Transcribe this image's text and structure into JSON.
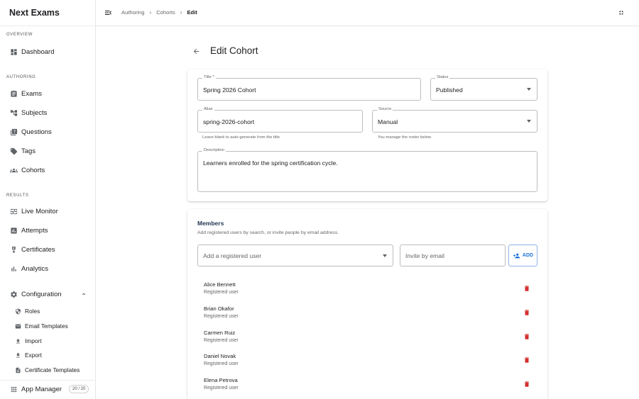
{
  "app": {
    "title": "Next Exams"
  },
  "sidebar": {
    "sections": {
      "overview": "OVERVIEW",
      "authoring": "AUTHORING",
      "results": "RESULTS"
    },
    "items": {
      "dashboard": "Dashboard",
      "exams": "Exams",
      "subjects": "Subjects",
      "questions": "Questions",
      "tags": "Tags",
      "cohorts": "Cohorts",
      "live_monitor": "Live Monitor",
      "attempts": "Attempts",
      "certificates": "Certificates",
      "analytics": "Analytics",
      "configuration": "Configuration",
      "app_manager": "App Manager"
    },
    "config_sub": {
      "roles": "Roles",
      "email_templates": "Email Templates",
      "import": "Import",
      "export": "Export",
      "certificate_templates": "Certificate Templates"
    },
    "badge": "20 / 20"
  },
  "breadcrumb": [
    "Authoring",
    "Cohorts",
    "Edit"
  ],
  "page": {
    "title": "Edit Cohort"
  },
  "form": {
    "title": {
      "label": "Title *",
      "value": "Spring 2026 Cohort"
    },
    "status": {
      "label": "Status",
      "value": "Published"
    },
    "alias": {
      "label": "Alias",
      "value": "spring-2026-cohort",
      "helper": "Leave blank to auto-generate from the title"
    },
    "source": {
      "label": "Source",
      "value": "Manual",
      "helper": "You manage the roster below"
    },
    "description": {
      "label": "Description",
      "value": "Learners enrolled for the spring certification cycle."
    }
  },
  "members": {
    "title": "Members",
    "subtitle": "Add registered users by search, or invite people by email address.",
    "search_placeholder": "Add a registered user",
    "invite_placeholder": "Invite by email",
    "add_label": "ADD",
    "list": [
      {
        "name": "Alice Bennett",
        "role": "Registered user"
      },
      {
        "name": "Brian Okafor",
        "role": "Registered user"
      },
      {
        "name": "Carmen Ruiz",
        "role": "Registered user"
      },
      {
        "name": "Daniel Novak",
        "role": "Registered user"
      },
      {
        "name": "Elena Petrova",
        "role": "Registered user"
      }
    ]
  },
  "colors": {
    "accent": "#1e73d8",
    "danger": "#d32f2f",
    "heading": "#1f3550"
  }
}
